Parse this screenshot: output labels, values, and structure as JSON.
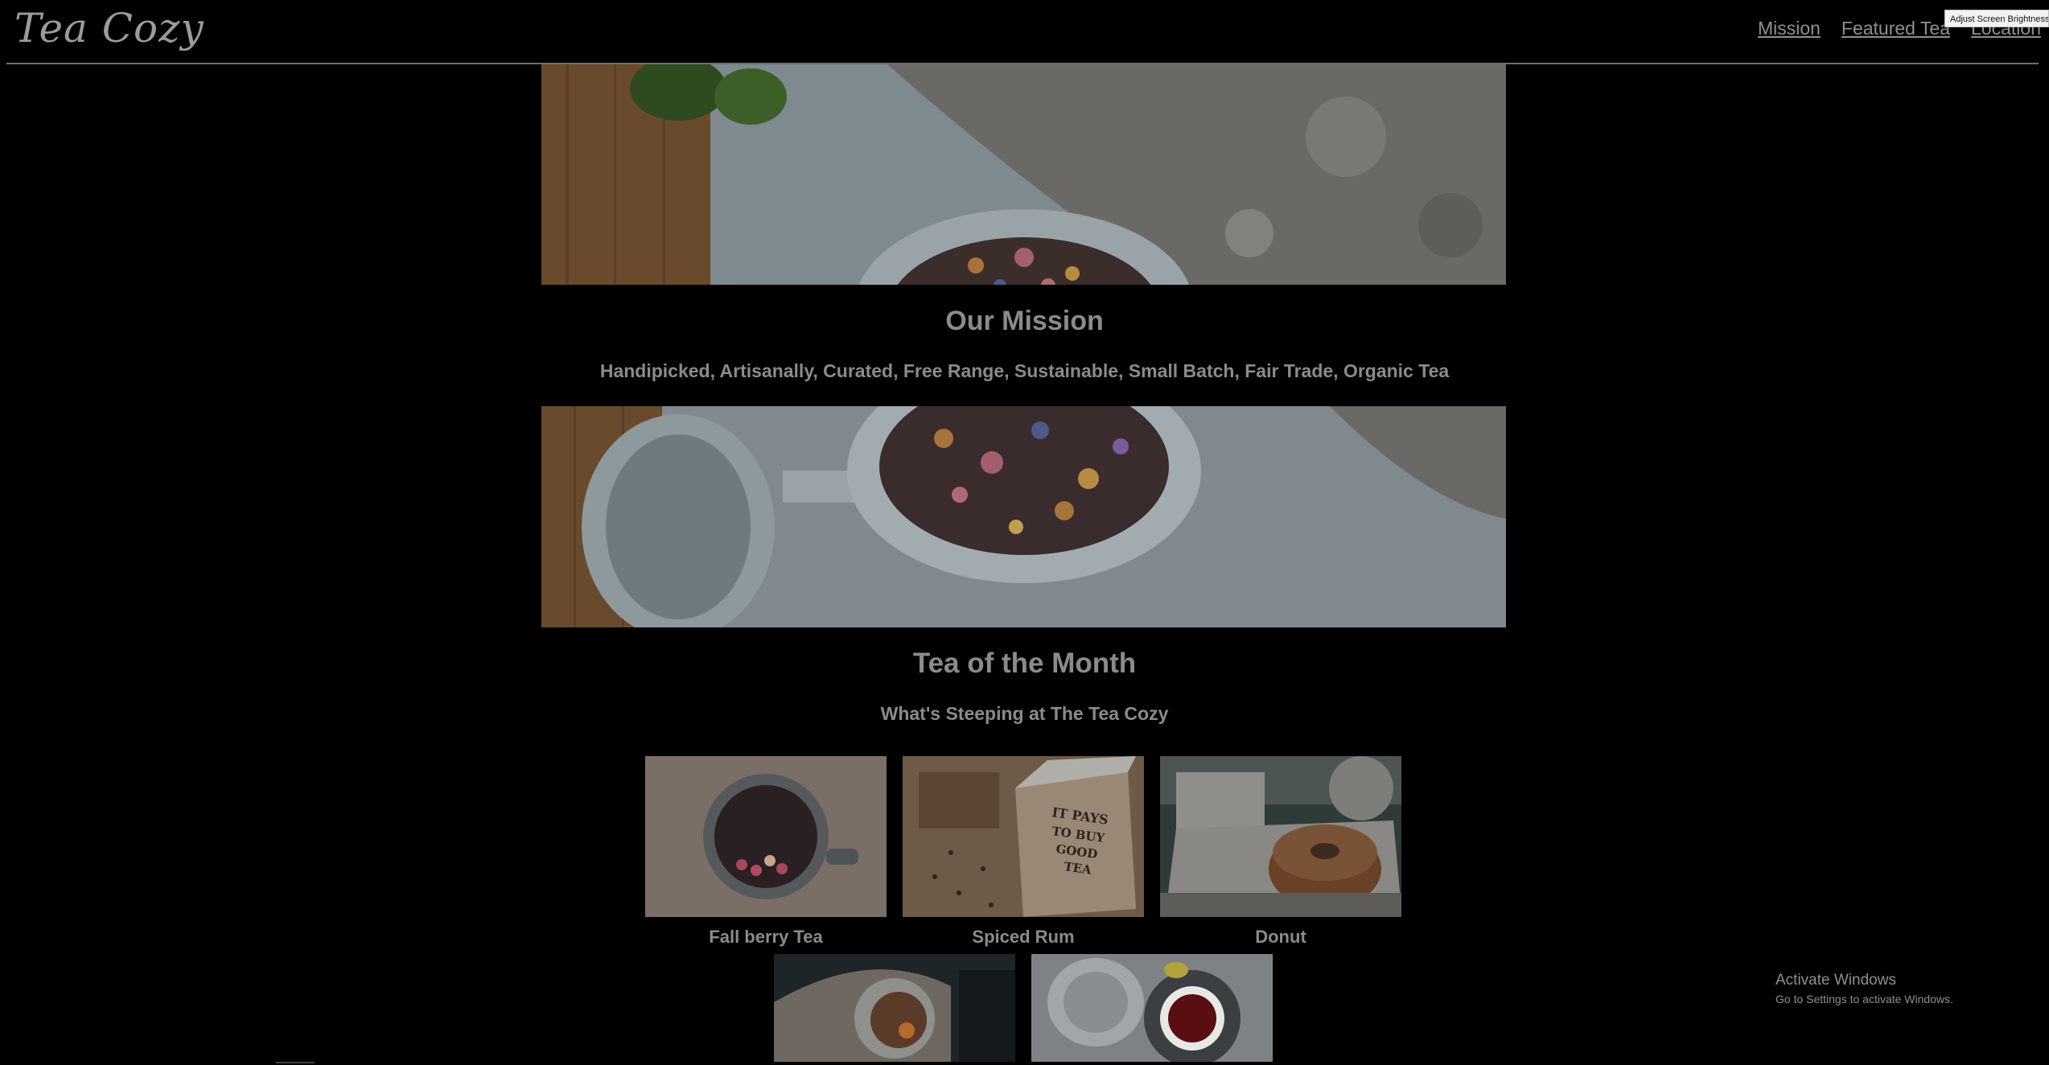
{
  "header": {
    "logo_text": "Tea Cozy",
    "nav": [
      {
        "label": "Mission"
      },
      {
        "label": "Featured Tea"
      },
      {
        "label": "Location"
      }
    ]
  },
  "tooltip_text": "Adjust Screen Brightness",
  "mission": {
    "title": "Our Mission",
    "subtitle": "Handipicked, Artisanally, Curated, Free Range, Sustainable, Small Batch, Fair Trade, Organic Tea"
  },
  "month": {
    "title": "Tea of the Month",
    "subtitle": "What's Steeping at The Tea Cozy",
    "items": [
      {
        "caption": "Fall berry Tea"
      },
      {
        "caption": "Spiced Rum"
      },
      {
        "caption": "Donut"
      },
      {
        "caption": ""
      },
      {
        "caption": ""
      }
    ],
    "spiced_rum_box_text": "IT PAYS TO BUY GOOD TEA"
  },
  "windows_watermark": {
    "line1": "Activate Windows",
    "line2": "Go to Settings to activate Windows."
  }
}
